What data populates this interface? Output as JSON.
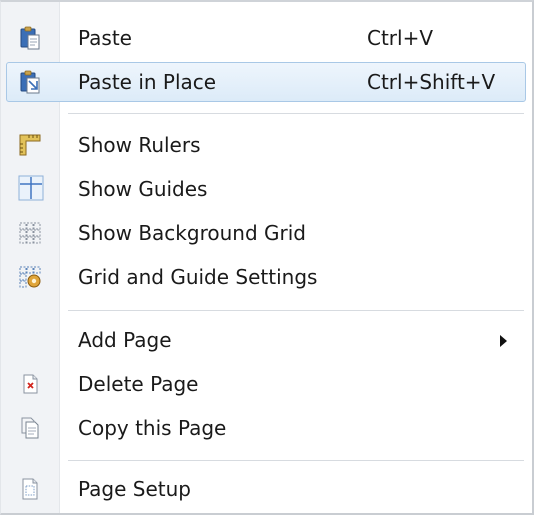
{
  "menu": {
    "paste": {
      "label": "Paste",
      "shortcut": "Ctrl+V",
      "icon": "paste-icon"
    },
    "paste_in_place": {
      "label": "Paste in Place",
      "shortcut": "Ctrl+Shift+V",
      "icon": "paste-in-place-icon"
    },
    "show_rulers": {
      "label": "Show Rulers",
      "icon": "ruler-icon"
    },
    "show_guides": {
      "label": "Show Guides",
      "icon": "guides-icon"
    },
    "show_background_grid": {
      "label": "Show Background Grid",
      "icon": "grid-icon"
    },
    "grid_guide_settings": {
      "label": "Grid and Guide Settings",
      "icon": "grid-settings-icon"
    },
    "add_page": {
      "label": "Add Page",
      "icon": "submenu-arrow-icon"
    },
    "delete_page": {
      "label": "Delete Page",
      "icon": "delete-page-icon"
    },
    "copy_page": {
      "label": "Copy this Page",
      "icon": "copy-page-icon"
    },
    "page_setup": {
      "label": "Page Setup",
      "icon": "page-setup-icon"
    }
  },
  "colors": {
    "hover_bg_top": "#eef5fc",
    "hover_bg_bottom": "#dcebf8",
    "hover_border": "#a9c8e6",
    "gutter": "#f1f3f6",
    "separator": "#d7dbe0"
  }
}
